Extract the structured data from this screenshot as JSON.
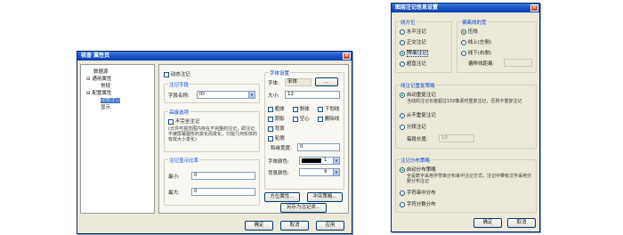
{
  "win1": {
    "title": "核查 属性页",
    "tree": {
      "items": [
        "数据源",
        "通用属性",
        "常规",
        "配置属性",
        "动态注记",
        "显示"
      ]
    },
    "dynamic_label_checkbox": "动态注记",
    "label_field_group": {
      "legend": "注记字段",
      "field_name_label": "字段名称:",
      "field_name_value": "ID"
    },
    "advanced_group": {
      "legend": "高级选项",
      "incomplete_checkbox": "不完全注记",
      "description": "(允许可视范围内存在不完整的注记，即注记不被屏幕图形的变化而变化，只能几何实体的有效大小变化)"
    },
    "scale_group": {
      "legend": "注记显示比率",
      "min_label": "最小:",
      "min_value": "0",
      "max_label": "最大:",
      "max_value": "0"
    },
    "font_group": {
      "legend": "字体设置",
      "font_label": "字体:",
      "font_value": "宋体",
      "browse_button": "...",
      "size_label": "大小:",
      "size_value": "12",
      "styles": [
        "粗体",
        "斜体",
        "下划线",
        "阴影",
        "空心",
        "删除线",
        "背景",
        "轮廓"
      ],
      "spacing_label": "和缘宽度:",
      "spacing_value": "0",
      "font_color_label": "字体颜色:",
      "font_color_value": "1",
      "bg_color_label": "背景颜色:",
      "bg_color_value": "9"
    },
    "position_button": "方位属性...",
    "conflict_button": "冲突策略...",
    "save_as_button": "另存为注记类...",
    "ok_button": "确定",
    "cancel_button": "取消",
    "apply_button": "应用"
  },
  "win2": {
    "title": "图层注记信息设置",
    "direction_group": {
      "legend": "线方位",
      "options": [
        "水平注记",
        "正交注记",
        "等曲注记",
        "超直注记"
      ],
      "selected_index": 2
    },
    "offset_group": {
      "legend": "偏离线的宽",
      "options": [
        "压线",
        "线上(左侧)",
        "线下(右侧)"
      ],
      "selected_index": 0,
      "offset_label": "偏移线距离:"
    },
    "overlap_group": {
      "legend": "线注记重复策略",
      "options": [
        "自动重复注记",
        "从不重复注记",
        "分段注记"
      ],
      "selected_index": 0,
      "description": "当线的注记长度超过150像素时重复注记，否则不重复注记",
      "segment_label": "每段长度:",
      "segment_value": "10"
    },
    "distribution_group": {
      "legend": "注记分布策略",
      "options": [
        "自动分布策略",
        "字符串中分布",
        "字符分数分布"
      ],
      "selected_index": 0,
      "description": "全是数字采用字符串分布来中注记方式，注记中带有汉字采用分数分布注记"
    },
    "ok_button": "确定",
    "cancel_button": "取消"
  },
  "colors": {
    "title_bar": "#1d56c8",
    "dialog_bg": "#ece9d8",
    "close_button": "#c4401d",
    "tree_selection": "#316ac5"
  }
}
